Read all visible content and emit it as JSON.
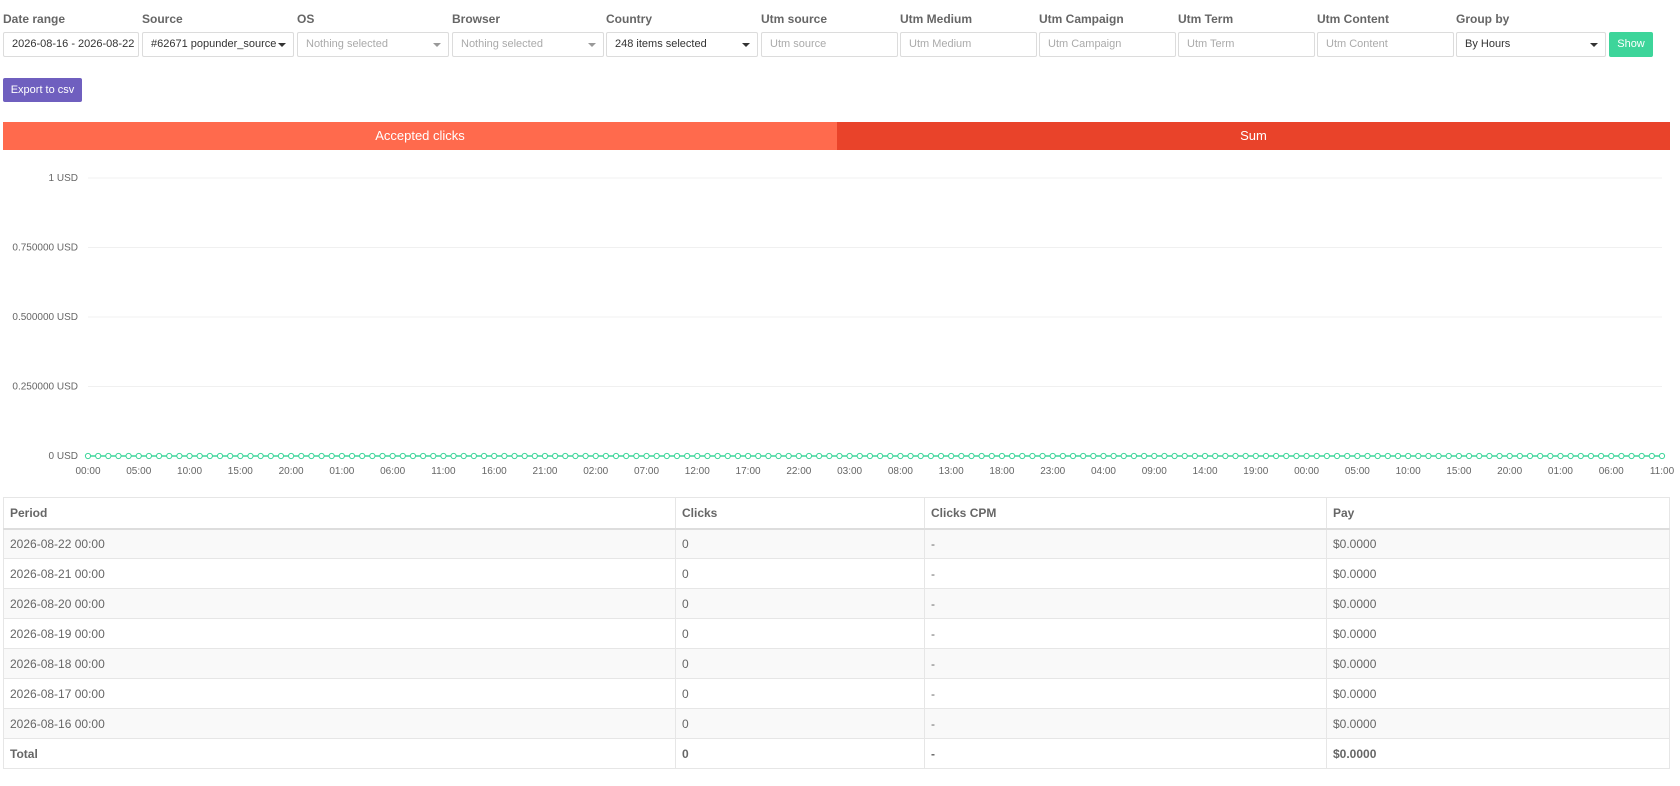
{
  "filters": {
    "date_range": {
      "label": "Date range",
      "value": "2026-08-16 - 2026-08-22"
    },
    "source": {
      "label": "Source",
      "value": "#62671 popunder_source"
    },
    "os": {
      "label": "OS",
      "value": "Nothing selected"
    },
    "browser": {
      "label": "Browser",
      "value": "Nothing selected"
    },
    "country": {
      "label": "Country",
      "value": "248 items selected"
    },
    "utm_source": {
      "label": "Utm source",
      "placeholder": "Utm source"
    },
    "utm_medium": {
      "label": "Utm Medium",
      "placeholder": "Utm Medium"
    },
    "utm_campaign": {
      "label": "Utm Campaign",
      "placeholder": "Utm Campaign"
    },
    "utm_term": {
      "label": "Utm Term",
      "placeholder": "Utm Term"
    },
    "utm_content": {
      "label": "Utm Content",
      "placeholder": "Utm Content"
    },
    "group_by": {
      "label": "Group by",
      "value": "By Hours"
    },
    "show_label": "Show"
  },
  "export_label": "Export to csv",
  "tabs": [
    {
      "label": "Accepted clicks",
      "color": "#ff6a4d"
    },
    {
      "label": "Sum",
      "color": "#e9432a"
    }
  ],
  "chart_data": {
    "type": "line",
    "y_ticks": [
      "1 USD",
      "0.750000 USD",
      "0.500000 USD",
      "0.250000 USD",
      "0 USD"
    ],
    "ylim": [
      0,
      1
    ],
    "x_tick_labels": [
      "00:00",
      "05:00",
      "10:00",
      "15:00",
      "20:00",
      "01:00",
      "06:00",
      "11:00",
      "16:00",
      "21:00",
      "02:00",
      "07:00",
      "12:00",
      "17:00",
      "22:00",
      "03:00",
      "08:00",
      "13:00",
      "18:00",
      "23:00",
      "04:00",
      "09:00",
      "14:00",
      "19:00",
      "00:00",
      "05:00",
      "10:00",
      "15:00",
      "20:00",
      "01:00",
      "06:00",
      "11:00"
    ],
    "point_count": 156,
    "series": [
      {
        "value": 0,
        "color": "#3dd59a"
      }
    ],
    "grid": true
  },
  "table": {
    "headers": [
      "Period",
      "Clicks",
      "Clicks CPM",
      "Pay"
    ],
    "rows": [
      [
        "2026-08-22 00:00",
        "0",
        "-",
        "$0.0000"
      ],
      [
        "2026-08-21 00:00",
        "0",
        "-",
        "$0.0000"
      ],
      [
        "2026-08-20 00:00",
        "0",
        "-",
        "$0.0000"
      ],
      [
        "2026-08-19 00:00",
        "0",
        "-",
        "$0.0000"
      ],
      [
        "2026-08-18 00:00",
        "0",
        "-",
        "$0.0000"
      ],
      [
        "2026-08-17 00:00",
        "0",
        "-",
        "$0.0000"
      ],
      [
        "2026-08-16 00:00",
        "0",
        "-",
        "$0.0000"
      ]
    ],
    "total": [
      "Total",
      "0",
      "-",
      "$0.0000"
    ]
  }
}
